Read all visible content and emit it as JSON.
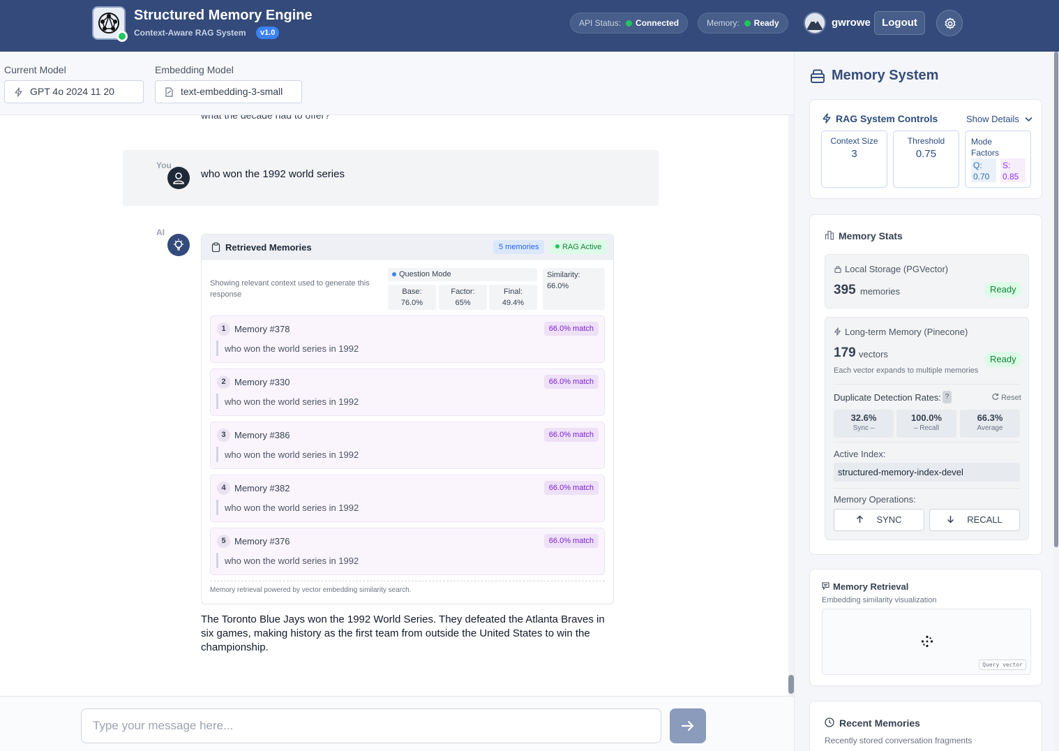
{
  "header": {
    "title": "Structured Memory Engine",
    "subtitle": "Context-Aware RAG System",
    "version": "v1.0",
    "api_status_label": "API Status:",
    "api_status_value": "Connected",
    "memory_label": "Memory:",
    "memory_value": "Ready",
    "username": "gwrowe",
    "logout_label": "Logout",
    "status_color": "#22c55e"
  },
  "models": {
    "current_label": "Current Model",
    "current_value": "GPT 4o 2024 11 20",
    "embedding_label": "Embedding Model",
    "embedding_value": "text-embedding-3-small"
  },
  "chat": {
    "previous_fragment": "what the decade had to offer?",
    "user_role": "You",
    "user_message": "who won the 1992 world series",
    "ai_role": "AI",
    "retrieved": {
      "title": "Retrieved Memories",
      "count_badge": "5 memories",
      "rag_badge": "RAG Active",
      "description": "Showing relevant context used to generate this response",
      "mode": "Question Mode",
      "base_label": "Base:",
      "base_value": "76.0%",
      "factor_label": "Factor:",
      "factor_value": "65%",
      "final_label": "Final:",
      "final_value": "49.4%",
      "similarity_label": "Similarity:",
      "similarity_value": "66.0%",
      "items": [
        {
          "num": "1",
          "title": "Memory #378",
          "match": "66.0% match",
          "text": "who won the world series in 1992"
        },
        {
          "num": "2",
          "title": "Memory #330",
          "match": "66.0% match",
          "text": "who won the world series in 1992"
        },
        {
          "num": "3",
          "title": "Memory #386",
          "match": "66.0% match",
          "text": "who won the world series in 1992"
        },
        {
          "num": "4",
          "title": "Memory #382",
          "match": "66.0% match",
          "text": "who won the world series in 1992"
        },
        {
          "num": "5",
          "title": "Memory #376",
          "match": "66.0% match",
          "text": "who won the world series in 1992"
        }
      ],
      "footer": "Memory retrieval powered by vector embedding similarity search."
    },
    "ai_answer": "The Toronto Blue Jays won the 1992 World Series. They defeated the Atlanta Braves in six games, making history as the first team from outside the United States to win the championship.",
    "input_placeholder": "Type your message here..."
  },
  "panel": {
    "title": "Memory System",
    "rag": {
      "title": "RAG System Controls",
      "toggle": "Show Details",
      "context_label": "Context Size",
      "context_value": "3",
      "threshold_label": "Threshold",
      "threshold_value": "0.75",
      "mode_label": "Mode Factors",
      "q_label": "Q:",
      "q_value": "0.70",
      "s_label": "S:",
      "s_value": "0.85"
    },
    "stats": {
      "title": "Memory Stats",
      "local_label": "Local Storage (PGVector)",
      "local_count": "395",
      "local_unit": "memories",
      "local_status": "Ready",
      "pinecone_label": "Long-term Memory (Pinecone)",
      "pinecone_count": "179",
      "pinecone_unit": "vectors",
      "pinecone_status": "Ready",
      "pinecone_note": "Each vector expands to multiple memories",
      "dup_label": "Duplicate Detection Rates:",
      "dup_help": "?",
      "reset_label": "Reset",
      "sync_value": "32.6%",
      "sync_label": "Sync –",
      "recall_value": "100.0%",
      "recall_label": "– Recall",
      "avg_value": "66.3%",
      "avg_label": "Average",
      "index_label": "Active Index:",
      "index_value": "structured-memory-index-devel",
      "ops_label": "Memory Operations:",
      "sync_button": "SYNC",
      "recall_button": "RECALL"
    },
    "retrieval": {
      "title": "Memory Retrieval",
      "subtitle": "Embedding similarity visualization",
      "query_tag": "Query vector"
    },
    "recent": {
      "title": "Recent Memories",
      "subtitle": "Recently stored conversation fragments"
    }
  }
}
